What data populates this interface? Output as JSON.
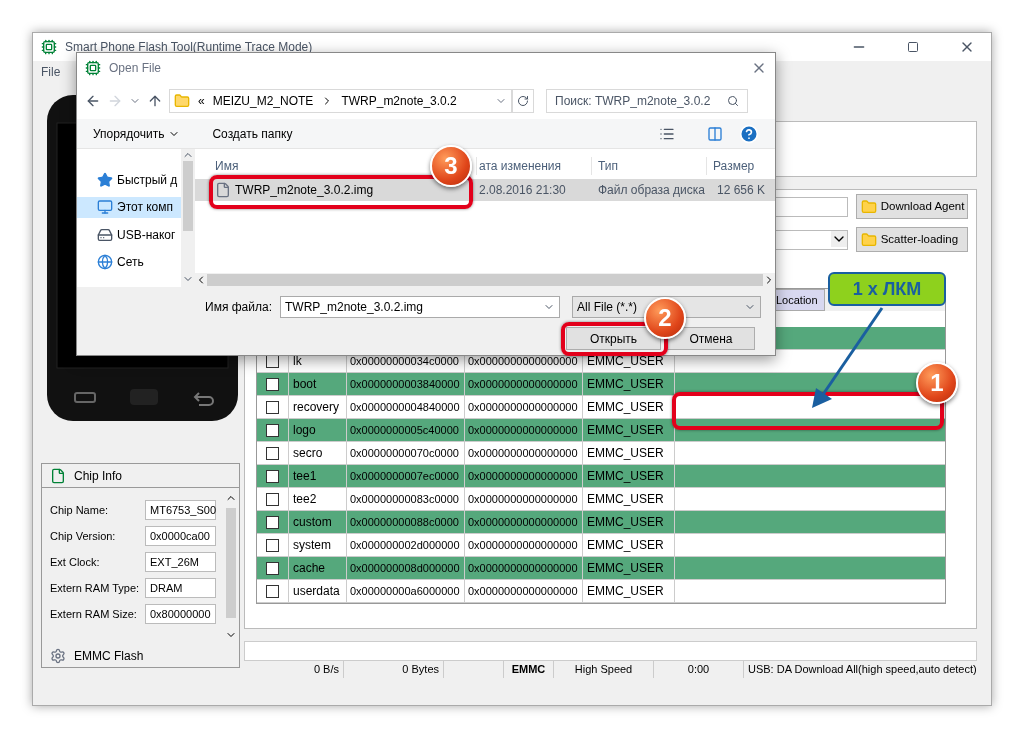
{
  "main_window": {
    "title": "Smart Phone Flash Tool(Runtime Trace Mode)",
    "menu": [
      "File"
    ],
    "download_agent": "Download Agent",
    "scatter_loading": "Scatter-loading",
    "table": {
      "location_header": "Location",
      "rows": [
        {
          "name": "lk",
          "begin": "0x00000000034c0000",
          "end": "0x0000000000000000",
          "region": "EMMC_USER",
          "checked": false
        },
        {
          "name": "boot",
          "begin": "0x0000000003840000",
          "end": "0x0000000000000000",
          "region": "EMMC_USER",
          "checked": false
        },
        {
          "name": "recovery",
          "begin": "0x0000000004840000",
          "end": "0x0000000000000000",
          "region": "EMMC_USER",
          "checked": false
        },
        {
          "name": "logo",
          "begin": "0x0000000005c40000",
          "end": "0x0000000000000000",
          "region": "EMMC_USER",
          "checked": false
        },
        {
          "name": "secro",
          "begin": "0x00000000070c0000",
          "end": "0x0000000000000000",
          "region": "EMMC_USER",
          "checked": false
        },
        {
          "name": "tee1",
          "begin": "0x0000000007ec0000",
          "end": "0x0000000000000000",
          "region": "EMMC_USER",
          "checked": false
        },
        {
          "name": "tee2",
          "begin": "0x00000000083c0000",
          "end": "0x0000000000000000",
          "region": "EMMC_USER",
          "checked": false
        },
        {
          "name": "custom",
          "begin": "0x00000000088c0000",
          "end": "0x0000000000000000",
          "region": "EMMC_USER",
          "checked": false
        },
        {
          "name": "system",
          "begin": "0x000000002d000000",
          "end": "0x0000000000000000",
          "region": "EMMC_USER",
          "checked": false
        },
        {
          "name": "cache",
          "begin": "0x000000008d000000",
          "end": "0x0000000000000000",
          "region": "EMMC_USER",
          "checked": false
        },
        {
          "name": "userdata",
          "begin": "0x00000000a6000000",
          "end": "0x0000000000000000",
          "region": "EMMC_USER",
          "checked": false
        }
      ]
    },
    "chip_info": {
      "title": "Chip Info",
      "fields": [
        {
          "label": "Chip Name:",
          "value": "MT6753_S00"
        },
        {
          "label": "Chip Version:",
          "value": "0x0000ca00"
        },
        {
          "label": "Ext Clock:",
          "value": "EXT_26M"
        },
        {
          "label": "Extern RAM Type:",
          "value": "DRAM"
        },
        {
          "label": "Extern RAM Size:",
          "value": "0x80000000"
        }
      ],
      "emmc": "EMMC Flash"
    },
    "status_bar": {
      "speed": "0 B/s",
      "bytes": "0 Bytes",
      "storage": "EMMC",
      "mode": "High Speed",
      "time": "0:00",
      "usb": "USB: DA Download All(high speed,auto detect)"
    }
  },
  "dialog": {
    "title": "Open File",
    "path_prefix": "«",
    "path": [
      "MEIZU_M2_NOTE",
      "TWRP_m2note_3.0.2"
    ],
    "search_placeholder": "Поиск: TWRP_m2note_3.0.2",
    "organize": "Упорядочить",
    "new_folder": "Создать папку",
    "nav_items": [
      {
        "label": "Быстрый д",
        "kind": "star",
        "selected": false
      },
      {
        "label": "Этот комп",
        "kind": "computer",
        "selected": true
      },
      {
        "label": "USB-наког",
        "kind": "drive",
        "selected": false
      },
      {
        "label": "Сеть",
        "kind": "network",
        "selected": false
      }
    ],
    "columns": [
      "Имя",
      "ата изменения",
      "Тип",
      "Размер"
    ],
    "files": [
      {
        "name": "TWRP_m2note_3.0.2.img",
        "date": "2.08.2016 21:30",
        "type": "Файл образа диска",
        "size": "12 656 K",
        "selected": true
      }
    ],
    "filename_label": "Имя файла:",
    "filename": "TWRP_m2note_3.0.2.img",
    "filter": "All File (*.*)",
    "open": "Открыть",
    "cancel": "Отмена"
  },
  "annotations": {
    "callout": "1 x ЛКМ",
    "badges": [
      "3",
      "2",
      "1"
    ]
  }
}
